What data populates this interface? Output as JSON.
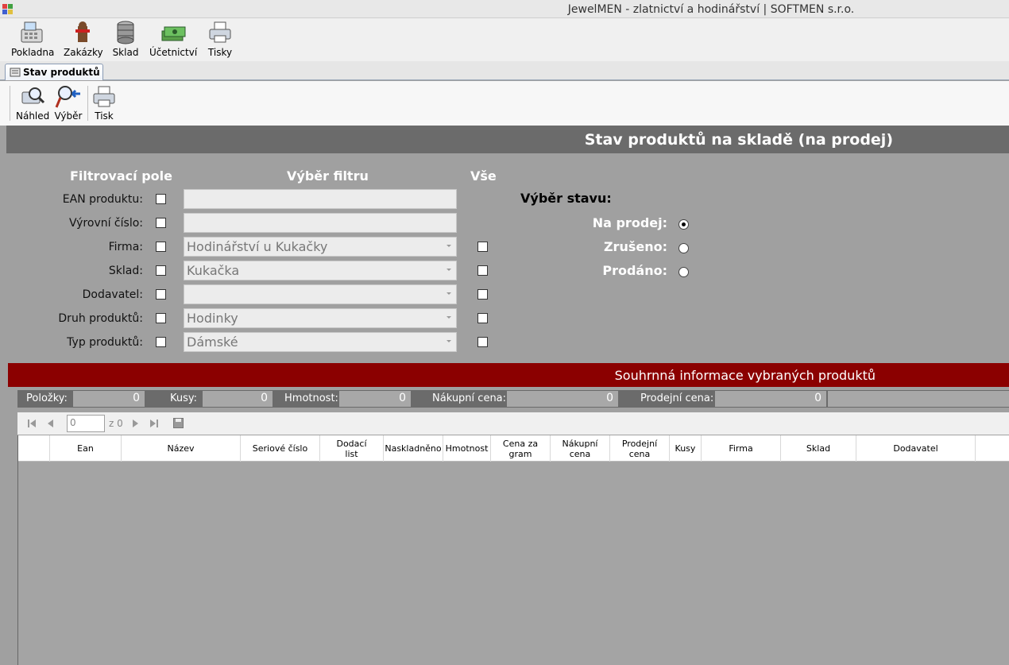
{
  "window": {
    "title": "JewelMEN - zlatnictví a hodinářství | SOFTMEN s.r.o."
  },
  "main_toolbar": [
    {
      "label": "Pokladna",
      "icon": "cash-register-icon"
    },
    {
      "label": "Zakázky",
      "icon": "orders-icon"
    },
    {
      "label": "Sklad",
      "icon": "database-icon"
    },
    {
      "label": "Účetnictví",
      "icon": "money-icon"
    },
    {
      "label": "Tisky",
      "icon": "printer-icon"
    }
  ],
  "tab": {
    "label": "Stav produktů",
    "icon": "report-icon"
  },
  "sub_toolbar": [
    {
      "label": "Náhled",
      "icon": "preview-icon"
    },
    {
      "label": "Výběr",
      "icon": "select-icon"
    },
    {
      "label": "Tisk",
      "icon": "printer-icon"
    }
  ],
  "header": {
    "title": "Stav produktů na skladě (na prodej)"
  },
  "filter": {
    "col_filter": "Filtrovací pole",
    "col_select": "Výběr filtru",
    "col_all": "Vše",
    "rows": [
      {
        "label": "EAN produktu:",
        "type": "text",
        "value": ""
      },
      {
        "label": "Výrovní číslo:",
        "type": "text",
        "value": ""
      },
      {
        "label": "Firma:",
        "type": "combo",
        "value": "Hodinářství u Kukačky"
      },
      {
        "label": "Sklad:",
        "type": "combo",
        "value": "Kukačka"
      },
      {
        "label": "Dodavatel:",
        "type": "combo",
        "value": ""
      },
      {
        "label": "Druh produktů:",
        "type": "combo",
        "value": "Hodinky"
      },
      {
        "label": "Typ produktů:",
        "type": "combo",
        "value": "Dámské"
      }
    ]
  },
  "state": {
    "title": "Výběr stavu:",
    "options": [
      {
        "label": "Na prodej:",
        "selected": true
      },
      {
        "label": "Zrušeno:",
        "selected": false
      },
      {
        "label": "Prodáno:",
        "selected": false
      }
    ]
  },
  "summary": {
    "title": "Souhrnná informace vybraných produktů",
    "polozky_label": "Položky:",
    "polozky_value": "0",
    "kusy_label": "Kusy:",
    "kusy_value": "0",
    "hmotnost_label": "Hmotnost:",
    "hmotnost_value": "0",
    "nakupni_label": "Nákupní cena:",
    "nakupni_value": "0",
    "prodejni_label": "Prodejní cena:",
    "prodejni_value": "0"
  },
  "navigator": {
    "position": "0",
    "count": "z 0"
  },
  "grid": {
    "columns": [
      "Ean",
      "Název",
      "Seriové číslo",
      "Dodací list",
      "Naskladněno",
      "Hmotnost",
      "Cena za gram",
      "Nákupní cena",
      "Prodejní cena",
      "Kusy",
      "Firma",
      "Sklad",
      "Dodavatel"
    ]
  },
  "colors": {
    "dark_red": "#8b0000",
    "header_grey": "#6b6b6b",
    "panel_grey": "#a0a0a0"
  }
}
